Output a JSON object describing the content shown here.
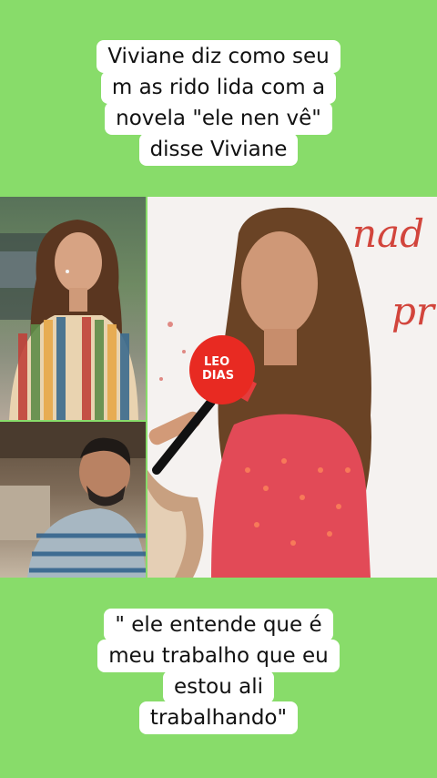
{
  "theme": {
    "background": "#88dc6a",
    "caption_bg": "#ffffff",
    "caption_text": "#111111"
  },
  "top_caption": {
    "lines": [
      "Viviane diz como seu",
      "m as rido lida com a",
      "novela \"ele nen vê\"",
      "disse Viviane"
    ]
  },
  "bottom_caption": {
    "lines": [
      "\" ele entende que é",
      "meu trabalho  que eu",
      "estou ali",
      "trabalhando\""
    ]
  },
  "backdrop_text": {
    "word1": "nad",
    "word2": "pr"
  },
  "microphone": {
    "brand_line1": "LEO",
    "brand_line2": "DIAS"
  }
}
